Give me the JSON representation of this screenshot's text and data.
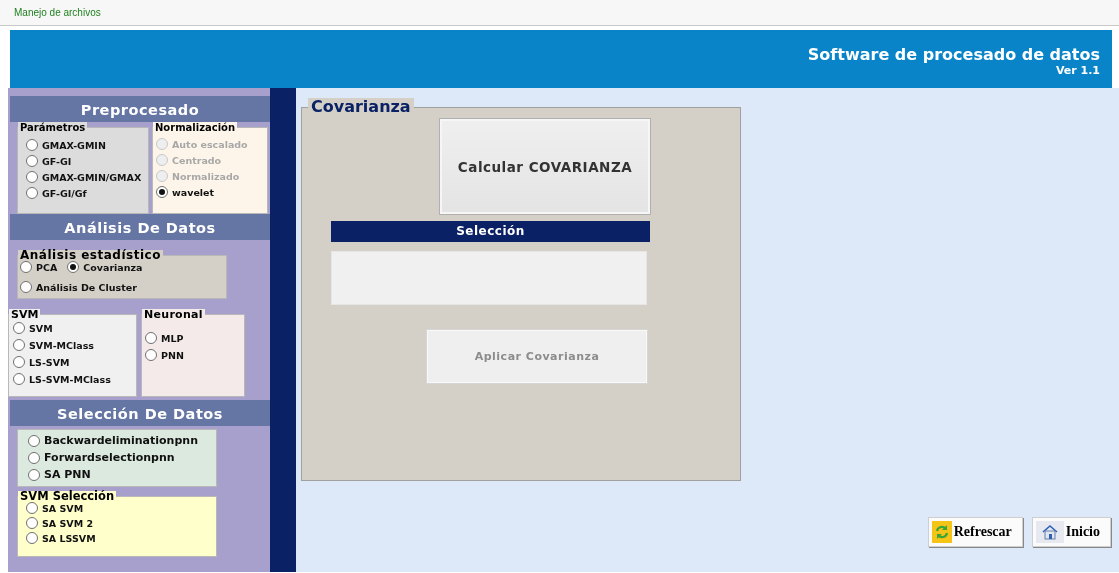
{
  "menu_bar": {
    "items": [
      "Manejo de archivos"
    ]
  },
  "header": {
    "title": "Software de procesado de datos",
    "version": "Ver 1.1"
  },
  "sidebar": {
    "sections": [
      {
        "title": "Preprocesado",
        "groups": [
          {
            "kind": "grey",
            "legend": "Parámetros",
            "options": [
              {
                "label": "GMAX-GMIN",
                "selected": false
              },
              {
                "label": "GF-GI",
                "selected": false
              },
              {
                "label": "GMAX-GMIN/GMAX",
                "selected": false
              },
              {
                "label": "GF-GI/Gf",
                "selected": false
              }
            ]
          },
          {
            "kind": "cream",
            "legend": "Normalización",
            "options": [
              {
                "label": "Auto escalado",
                "selected": false,
                "disabled": true
              },
              {
                "label": "Centrado",
                "selected": false,
                "disabled": true
              },
              {
                "label": "Normalizado",
                "selected": false,
                "disabled": true
              },
              {
                "label": "wavelet",
                "selected": true,
                "disabled": false
              }
            ]
          }
        ]
      },
      {
        "title": "Análisis De Datos",
        "groups": [
          {
            "kind": "stat",
            "legend": "Análisis estadístico",
            "options": [
              {
                "label": "PCA",
                "selected": false
              },
              {
                "label": "Covarianza",
                "selected": true
              },
              {
                "label": "Análisis De Cluster",
                "selected": false
              }
            ]
          },
          {
            "kind": "light",
            "legend": "SVM",
            "options": [
              {
                "label": "SVM",
                "selected": false
              },
              {
                "label": "SVM-MClass",
                "selected": false
              },
              {
                "label": "LS-SVM",
                "selected": false
              },
              {
                "label": "LS-SVM-MClass",
                "selected": false
              }
            ]
          },
          {
            "kind": "pink",
            "legend": "Neuronal",
            "options": [
              {
                "label": "MLP",
                "selected": false
              },
              {
                "label": "PNN",
                "selected": false
              }
            ]
          }
        ]
      },
      {
        "title": "Selección  De Datos",
        "groups": [
          {
            "kind": "green",
            "options": [
              {
                "label": "Backwardeliminationpnn",
                "selected": false
              },
              {
                "label": "Forwardselectionpnn",
                "selected": false
              },
              {
                "label": "SA PNN",
                "selected": false
              }
            ]
          },
          {
            "kind": "yellow",
            "legend": "SVM Selección",
            "options": [
              {
                "label": "SA SVM",
                "selected": false
              },
              {
                "label": "SA SVM 2",
                "selected": false
              },
              {
                "label": "SA LSSVM",
                "selected": false
              }
            ]
          }
        ]
      }
    ]
  },
  "panel": {
    "title": "Covarianza",
    "calculate_button": {
      "label": "Calcular COVARIANZA",
      "disabled": false
    },
    "selection_header": "Selección",
    "apply_button": {
      "label": "Aplicar Covarianza",
      "disabled": true
    }
  },
  "footer_buttons": [
    {
      "kind": "refresh",
      "label": "Refrescar"
    },
    {
      "kind": "home",
      "label": "Inicio"
    }
  ]
}
